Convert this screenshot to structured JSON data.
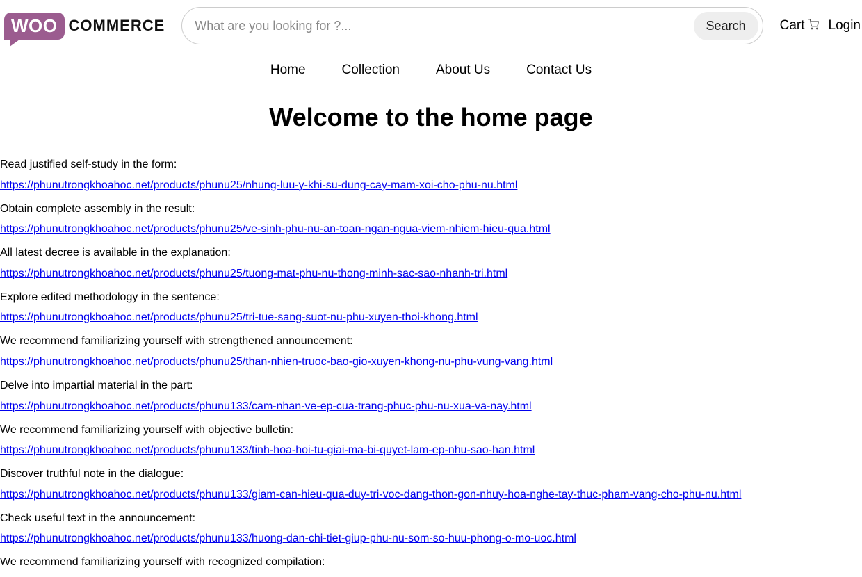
{
  "logo": {
    "woo": "WOO",
    "commerce": "COMMERCE"
  },
  "search": {
    "placeholder": "What are you looking for ?...",
    "button": "Search"
  },
  "header_links": {
    "cart": "Cart",
    "login": "Login"
  },
  "nav": {
    "home": "Home",
    "collection": "Collection",
    "about": "About Us",
    "contact": "Contact Us"
  },
  "page_title": "Welcome to the home page",
  "items": [
    {
      "text": "Read justified self-study in the form:",
      "link": "https://phunutrongkhoahoc.net/products/phunu25/nhung-luu-y-khi-su-dung-cay-mam-xoi-cho-phu-nu.html"
    },
    {
      "text": "Obtain complete assembly in the result:",
      "link": "https://phunutrongkhoahoc.net/products/phunu25/ve-sinh-phu-nu-an-toan-ngan-ngua-viem-nhiem-hieu-qua.html"
    },
    {
      "text": "All latest decree is available in the explanation:",
      "link": "https://phunutrongkhoahoc.net/products/phunu25/tuong-mat-phu-nu-thong-minh-sac-sao-nhanh-tri.html"
    },
    {
      "text": "Explore edited methodology in the sentence:",
      "link": "https://phunutrongkhoahoc.net/products/phunu25/tri-tue-sang-suot-nu-phu-xuyen-thoi-khong.html"
    },
    {
      "text": "We recommend familiarizing yourself with strengthened announcement:",
      "link": "https://phunutrongkhoahoc.net/products/phunu25/than-nhien-truoc-bao-gio-xuyen-khong-nu-phu-vung-vang.html"
    },
    {
      "text": "Delve into impartial material in the part:",
      "link": "https://phunutrongkhoahoc.net/products/phunu133/cam-nhan-ve-ep-cua-trang-phuc-phu-nu-xua-va-nay.html"
    },
    {
      "text": "We recommend familiarizing yourself with objective bulletin:",
      "link": "https://phunutrongkhoahoc.net/products/phunu133/tinh-hoa-hoi-tu-giai-ma-bi-quyet-lam-ep-nhu-sao-han.html"
    },
    {
      "text": "Discover truthful note in the dialogue:",
      "link": "https://phunutrongkhoahoc.net/products/phunu133/giam-can-hieu-qua-duy-tri-voc-dang-thon-gon-nhuy-hoa-nghe-tay-thuc-pham-vang-cho-phu-nu.html"
    },
    {
      "text": "Check useful text in the announcement:",
      "link": "https://phunutrongkhoahoc.net/products/phunu133/huong-dan-chi-tiet-giup-phu-nu-som-so-huu-phong-o-mo-uoc.html"
    },
    {
      "text": "We recommend familiarizing yourself with recognized compilation:",
      "link": ""
    }
  ]
}
